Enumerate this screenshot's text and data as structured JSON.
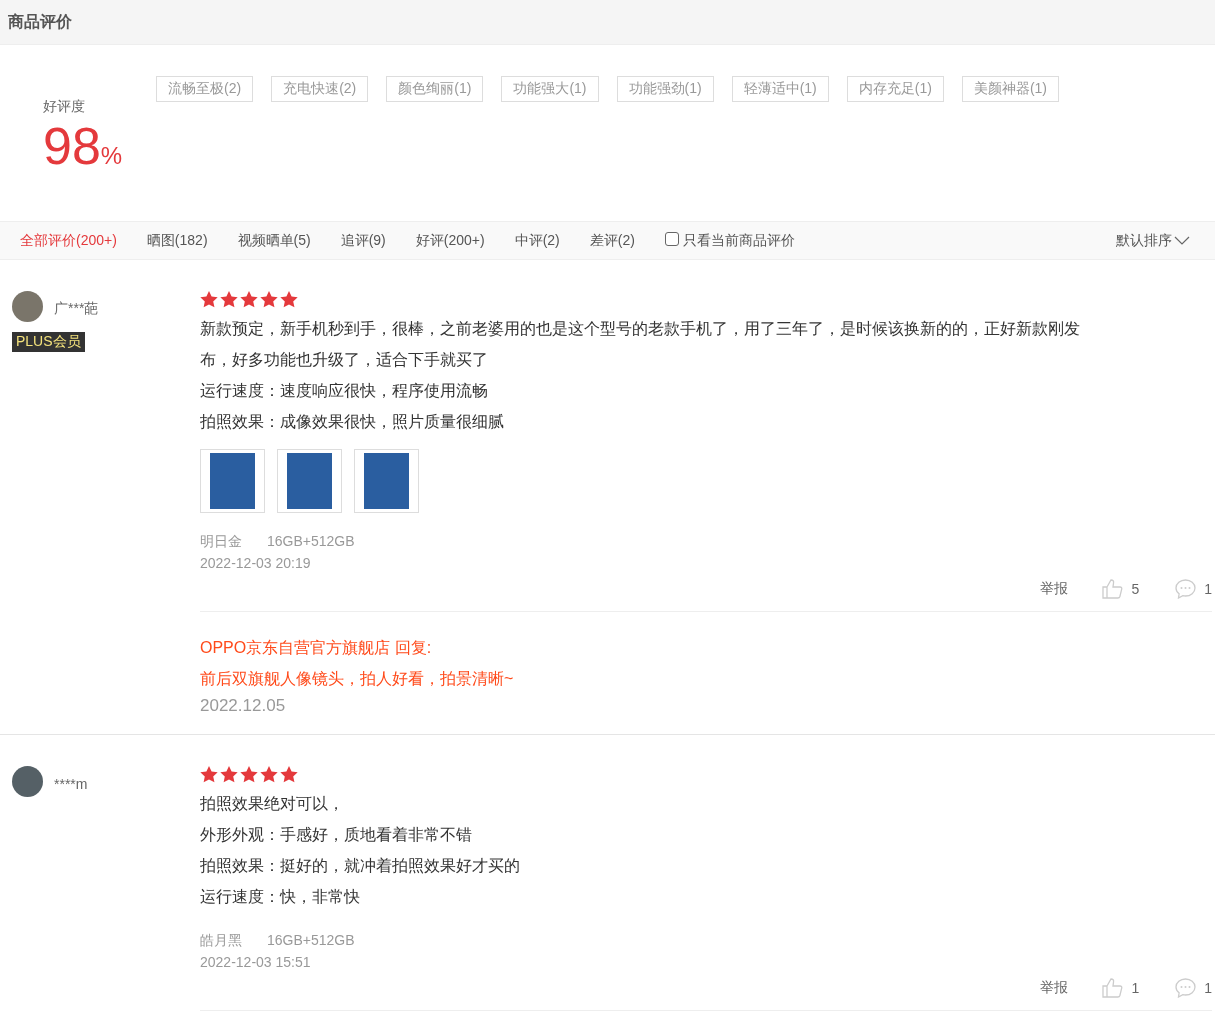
{
  "header": {
    "title": "商品评价"
  },
  "summary": {
    "label": "好评度",
    "value": "98",
    "unit": "%"
  },
  "tags": [
    "流畅至极(2)",
    "充电快速(2)",
    "颜色绚丽(1)",
    "功能强大(1)",
    "功能强劲(1)",
    "轻薄适中(1)",
    "内存充足(1)",
    "美颜神器(1)"
  ],
  "filters": [
    {
      "label": "全部评价(200+)",
      "selected": true
    },
    {
      "label": "晒图(182)",
      "selected": false
    },
    {
      "label": "视频晒单(5)",
      "selected": false
    },
    {
      "label": "追评(9)",
      "selected": false
    },
    {
      "label": "好评(200+)",
      "selected": false
    },
    {
      "label": "中评(2)",
      "selected": false
    },
    {
      "label": "差评(2)",
      "selected": false
    }
  ],
  "current_only": {
    "label": "只看当前商品评价",
    "checked": false
  },
  "sort": {
    "label": "默认排序"
  },
  "reviews": [
    {
      "user": "广***葩",
      "badge": "PLUS会员",
      "stars": 5,
      "paragraphs": [
        "新款预定，新手机秒到手，很棒，之前老婆用的也是这个型号的老款手机了，用了三年了，是时候该换新的的，正好新款刚发布，好多功能也升级了，适合下手就买了",
        "运行速度：速度响应很快，程序使用流畅",
        "拍照效果：成像效果很快，照片质量很细腻"
      ],
      "photos": [
        {
          "kind": "photo"
        },
        {
          "kind": "photo"
        },
        {
          "kind": "photo"
        }
      ],
      "variant": "明日金",
      "spec": "16GB+512GB",
      "time": "2022-12-03 20:19",
      "report": "举报",
      "likes": "5",
      "comments": "1",
      "reply": {
        "author": "OPPO京东自营官方旗舰店 回复:",
        "text": "前后双旗舰人像镜头，拍人好看，拍景清晰~",
        "date": "2022.12.05"
      }
    },
    {
      "user": "****m",
      "stars": 5,
      "paragraphs": [
        "拍照效果绝对可以，",
        "外形外观：手感好，质地看着非常不错",
        "拍照效果：挺好的，就冲着拍照效果好才买的",
        "运行速度：快，非常快"
      ],
      "variant": "皓月黑",
      "spec": "16GB+512GB",
      "time": "2022-12-03 15:51",
      "report": "举报",
      "likes": "1",
      "comments": "1"
    }
  ]
}
